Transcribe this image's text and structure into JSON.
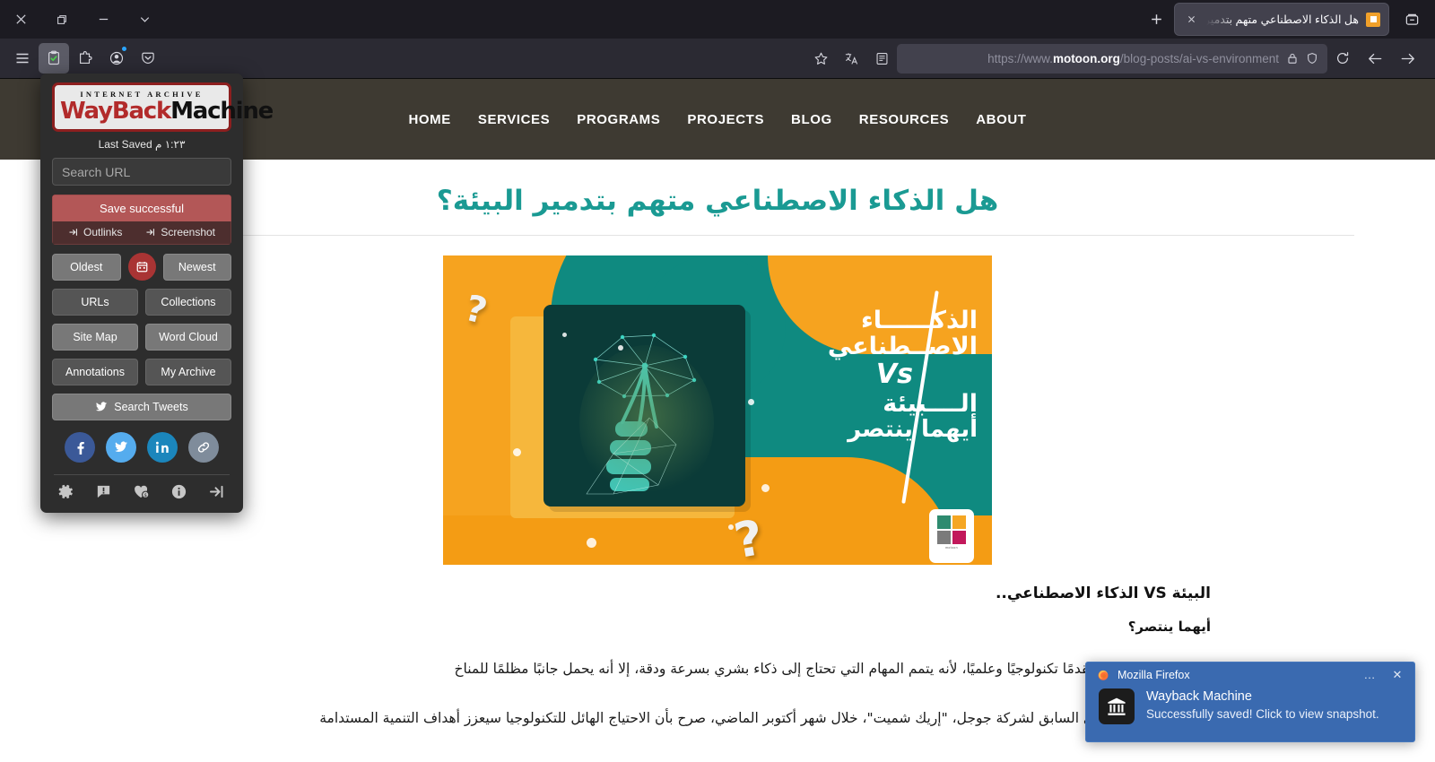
{
  "browser": {
    "window_controls": [
      {
        "name": "close-window",
        "glyph": "close"
      },
      {
        "name": "restore-window",
        "glyph": "restore"
      },
      {
        "name": "minimize-window",
        "glyph": "minimize"
      },
      {
        "name": "window-menu",
        "glyph": "chevron-down"
      }
    ],
    "tab": {
      "title": "هل الذكاء الاصطناعي متهم بتدمير البيئة؟",
      "favicon_color": "#f0a02a",
      "close_label": "✕"
    },
    "new_tab_label": "+",
    "list_all_tabs_label": "List all tabs",
    "toolbar_left": [
      {
        "name": "application-menu-icon",
        "label": "Application menu"
      },
      {
        "name": "wayback-machine-icon",
        "label": "Wayback Machine",
        "active": true
      },
      {
        "name": "extensions-icon",
        "label": "Extensions"
      },
      {
        "name": "account-icon",
        "label": "Account",
        "badge": true
      },
      {
        "name": "pocket-icon",
        "label": "Save to Pocket"
      }
    ],
    "url": {
      "scheme": "https://www.",
      "domain": "motoon.org",
      "path": "/blog-posts/ai-vs-environment",
      "full": "https://www.motoon.org/blog-posts/ai-vs-environment",
      "lock_icon": "lock-icon",
      "shield_icon": "shield-icon"
    },
    "nav_right": [
      {
        "name": "reload-icon",
        "label": "Reload"
      },
      {
        "name": "back-icon",
        "label": "Back"
      },
      {
        "name": "forward-icon",
        "label": "Forward"
      }
    ],
    "urlbar_icons": [
      {
        "name": "bookmark-star-icon",
        "label": "Bookmark this page"
      },
      {
        "name": "translate-icon",
        "label": "Translate this page"
      },
      {
        "name": "reader-view-icon",
        "label": "Reader view"
      }
    ]
  },
  "wayback": {
    "logo_top": "INTERNET ARCHIVE",
    "logo_way": "WayBack",
    "logo_machine": "Machine",
    "last_saved_label": "Last Saved",
    "last_saved_time": "١:٢٣ م",
    "search_placeholder": "Search URL",
    "save_status": "Save successful",
    "outlinks": "Outlinks",
    "screenshot": "Screenshot",
    "buttons": {
      "oldest": "Oldest",
      "newest": "Newest",
      "urls": "URLs",
      "collections": "Collections",
      "site_map": "Site Map",
      "word_cloud": "Word Cloud",
      "annotations": "Annotations",
      "my_archive": "My Archive",
      "search_tweets": "Search Tweets",
      "calendar": "calendar-icon"
    },
    "socials": [
      {
        "name": "facebook-share-button",
        "glyph": "f"
      },
      {
        "name": "twitter-share-button",
        "glyph": "twitter"
      },
      {
        "name": "linkedin-share-button",
        "glyph": "in"
      },
      {
        "name": "copy-link-button",
        "glyph": "link"
      }
    ],
    "footer_icons": [
      {
        "name": "settings-icon",
        "label": "Settings"
      },
      {
        "name": "report-problem-icon",
        "label": "Report a problem"
      },
      {
        "name": "donate-icon",
        "label": "Donate"
      },
      {
        "name": "about-info-icon",
        "label": "About"
      },
      {
        "name": "login-icon",
        "label": "Log in"
      }
    ]
  },
  "site": {
    "nav": [
      {
        "label": "HOME",
        "name": "nav-home"
      },
      {
        "label": "SERVICES",
        "name": "nav-services"
      },
      {
        "label": "PROGRAMS",
        "name": "nav-programs"
      },
      {
        "label": "PROJECTS",
        "name": "nav-projects"
      },
      {
        "label": "BLOG",
        "name": "nav-blog"
      },
      {
        "label": "RESOURCES",
        "name": "nav-resources"
      },
      {
        "label": "ABOUT",
        "name": "nav-about"
      }
    ],
    "header_bg": "#3e3a32",
    "article": {
      "title": "هل الذكاء الاصطناعي متهم بتدمير البيئة؟",
      "title_color": "#1a9a93",
      "hero": {
        "line1": "الذكــــــاء",
        "line2": "الاصــطناعي",
        "vs": "Vs",
        "line3": "الــــبيئة",
        "line4": "أيهما ينتصر",
        "orange": "#f6a31f",
        "teal": "#0f8a80",
        "logo_alt": "Motoon logo"
      },
      "subheading": "البيئة VS الذكاء الاصطناعي..",
      "subheading2": "أيهما ينتصر؟",
      "paragraph1": "تحسن الذكاء الاصطناعي تقدمًا تكنولوجيًا وعلميًا، لأنه يتمم المهام التي تحتاج إلى ذكاء بشري بسرعة ودقة، إلا أنه يحمل جانبًا مظلمًا للمناخ",
      "paragraph2": "في مقابلة للرئيس التنفيذي السابق لشركة جوجل، \"إريك شميت\"، خلال شهر أكتوبر الماضي، صرح بأن الاحتياج الهائل للتكنولوجيا سيعزز أهداف التنمية المستدامة"
    }
  },
  "notification": {
    "app_name": "Mozilla Firefox",
    "options_label": "…",
    "close_label": "✕",
    "title": "Wayback Machine",
    "message": "Successfully saved! Click to view snapshot.",
    "bg_color": "#3a6ab0"
  }
}
